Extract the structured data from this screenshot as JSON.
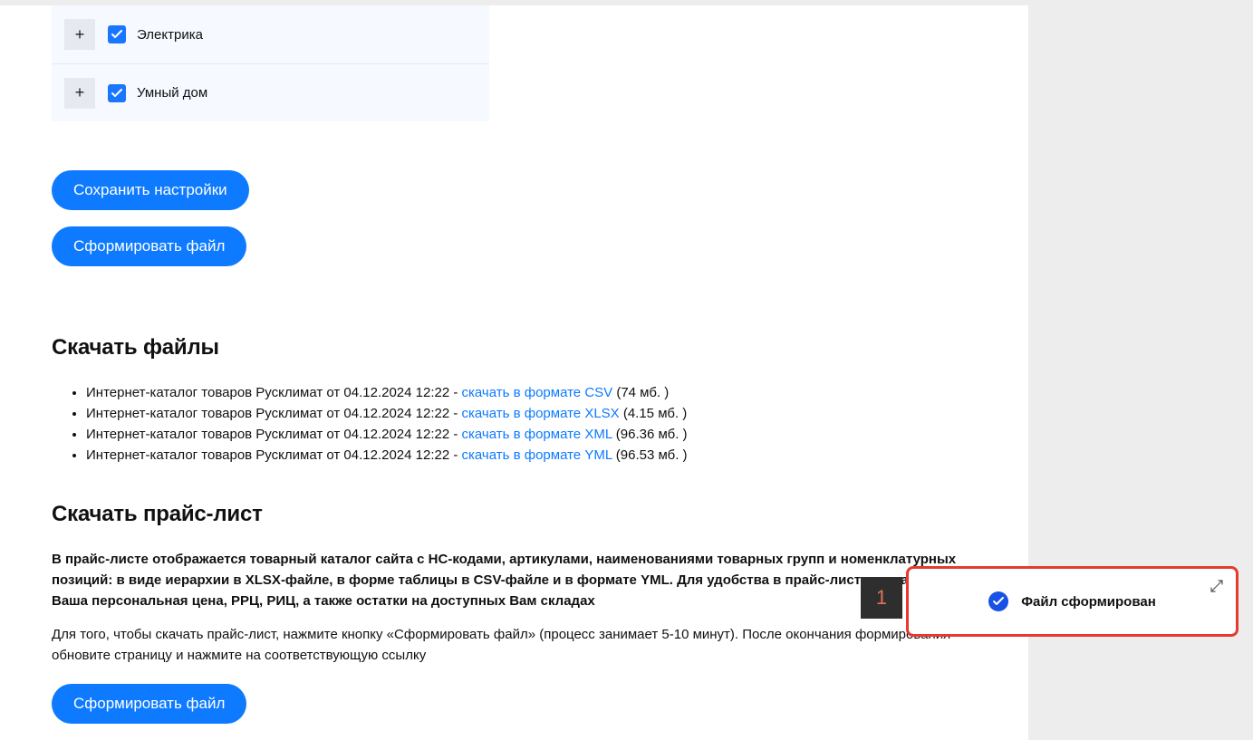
{
  "tree": {
    "items": [
      {
        "label": "Электрика"
      },
      {
        "label": "Умный дом"
      }
    ]
  },
  "buttons": {
    "save_settings": "Сохранить настройки",
    "generate_file_1": "Сформировать файл",
    "generate_file_2": "Сформировать файл"
  },
  "sections": {
    "download_files_title": "Скачать файлы",
    "download_price_title": "Скачать прайс-лист"
  },
  "files": [
    {
      "prefix": "Интернет-каталог товаров Русклимат от 04.12.2024 12:22 - ",
      "link": "скачать в формате CSV",
      "size": " (74 мб. )"
    },
    {
      "prefix": "Интернет-каталог товаров Русклимат от 04.12.2024 12:22 - ",
      "link": "скачать в формате XLSX",
      "size": " (4.15 мб. )"
    },
    {
      "prefix": "Интернет-каталог товаров Русклимат от 04.12.2024 12:22 - ",
      "link": "скачать в формате XML",
      "size": " (96.36 мб. )"
    },
    {
      "prefix": "Интернет-каталог товаров Русклимат от 04.12.2024 12:22 - ",
      "link": "скачать в формате YML",
      "size": " (96.53 мб. )"
    }
  ],
  "price_desc_bold": "В прайс-листе отображается товарный каталог сайта с НС-кодами, артикулами, наименованиями товарных групп и номенклатурных позиций: в виде иерархии в XLSX-файле, в форме таблицы в CSV-файле и в формате YML. Для удобства в прайс-листе указана Ваша персональная цена, РРЦ, РИЦ, а также остатки на доступных Вам складах",
  "price_desc_reg": "Для того, чтобы скачать прайс-лист, нажмите кнопку «Сформировать файл» (процесс занимает 5-10 минут). После окончания формирования обновите страницу и нажмите на соответствующую ссылку",
  "badge": {
    "number": "1"
  },
  "toast": {
    "text": "Файл сформирован"
  }
}
